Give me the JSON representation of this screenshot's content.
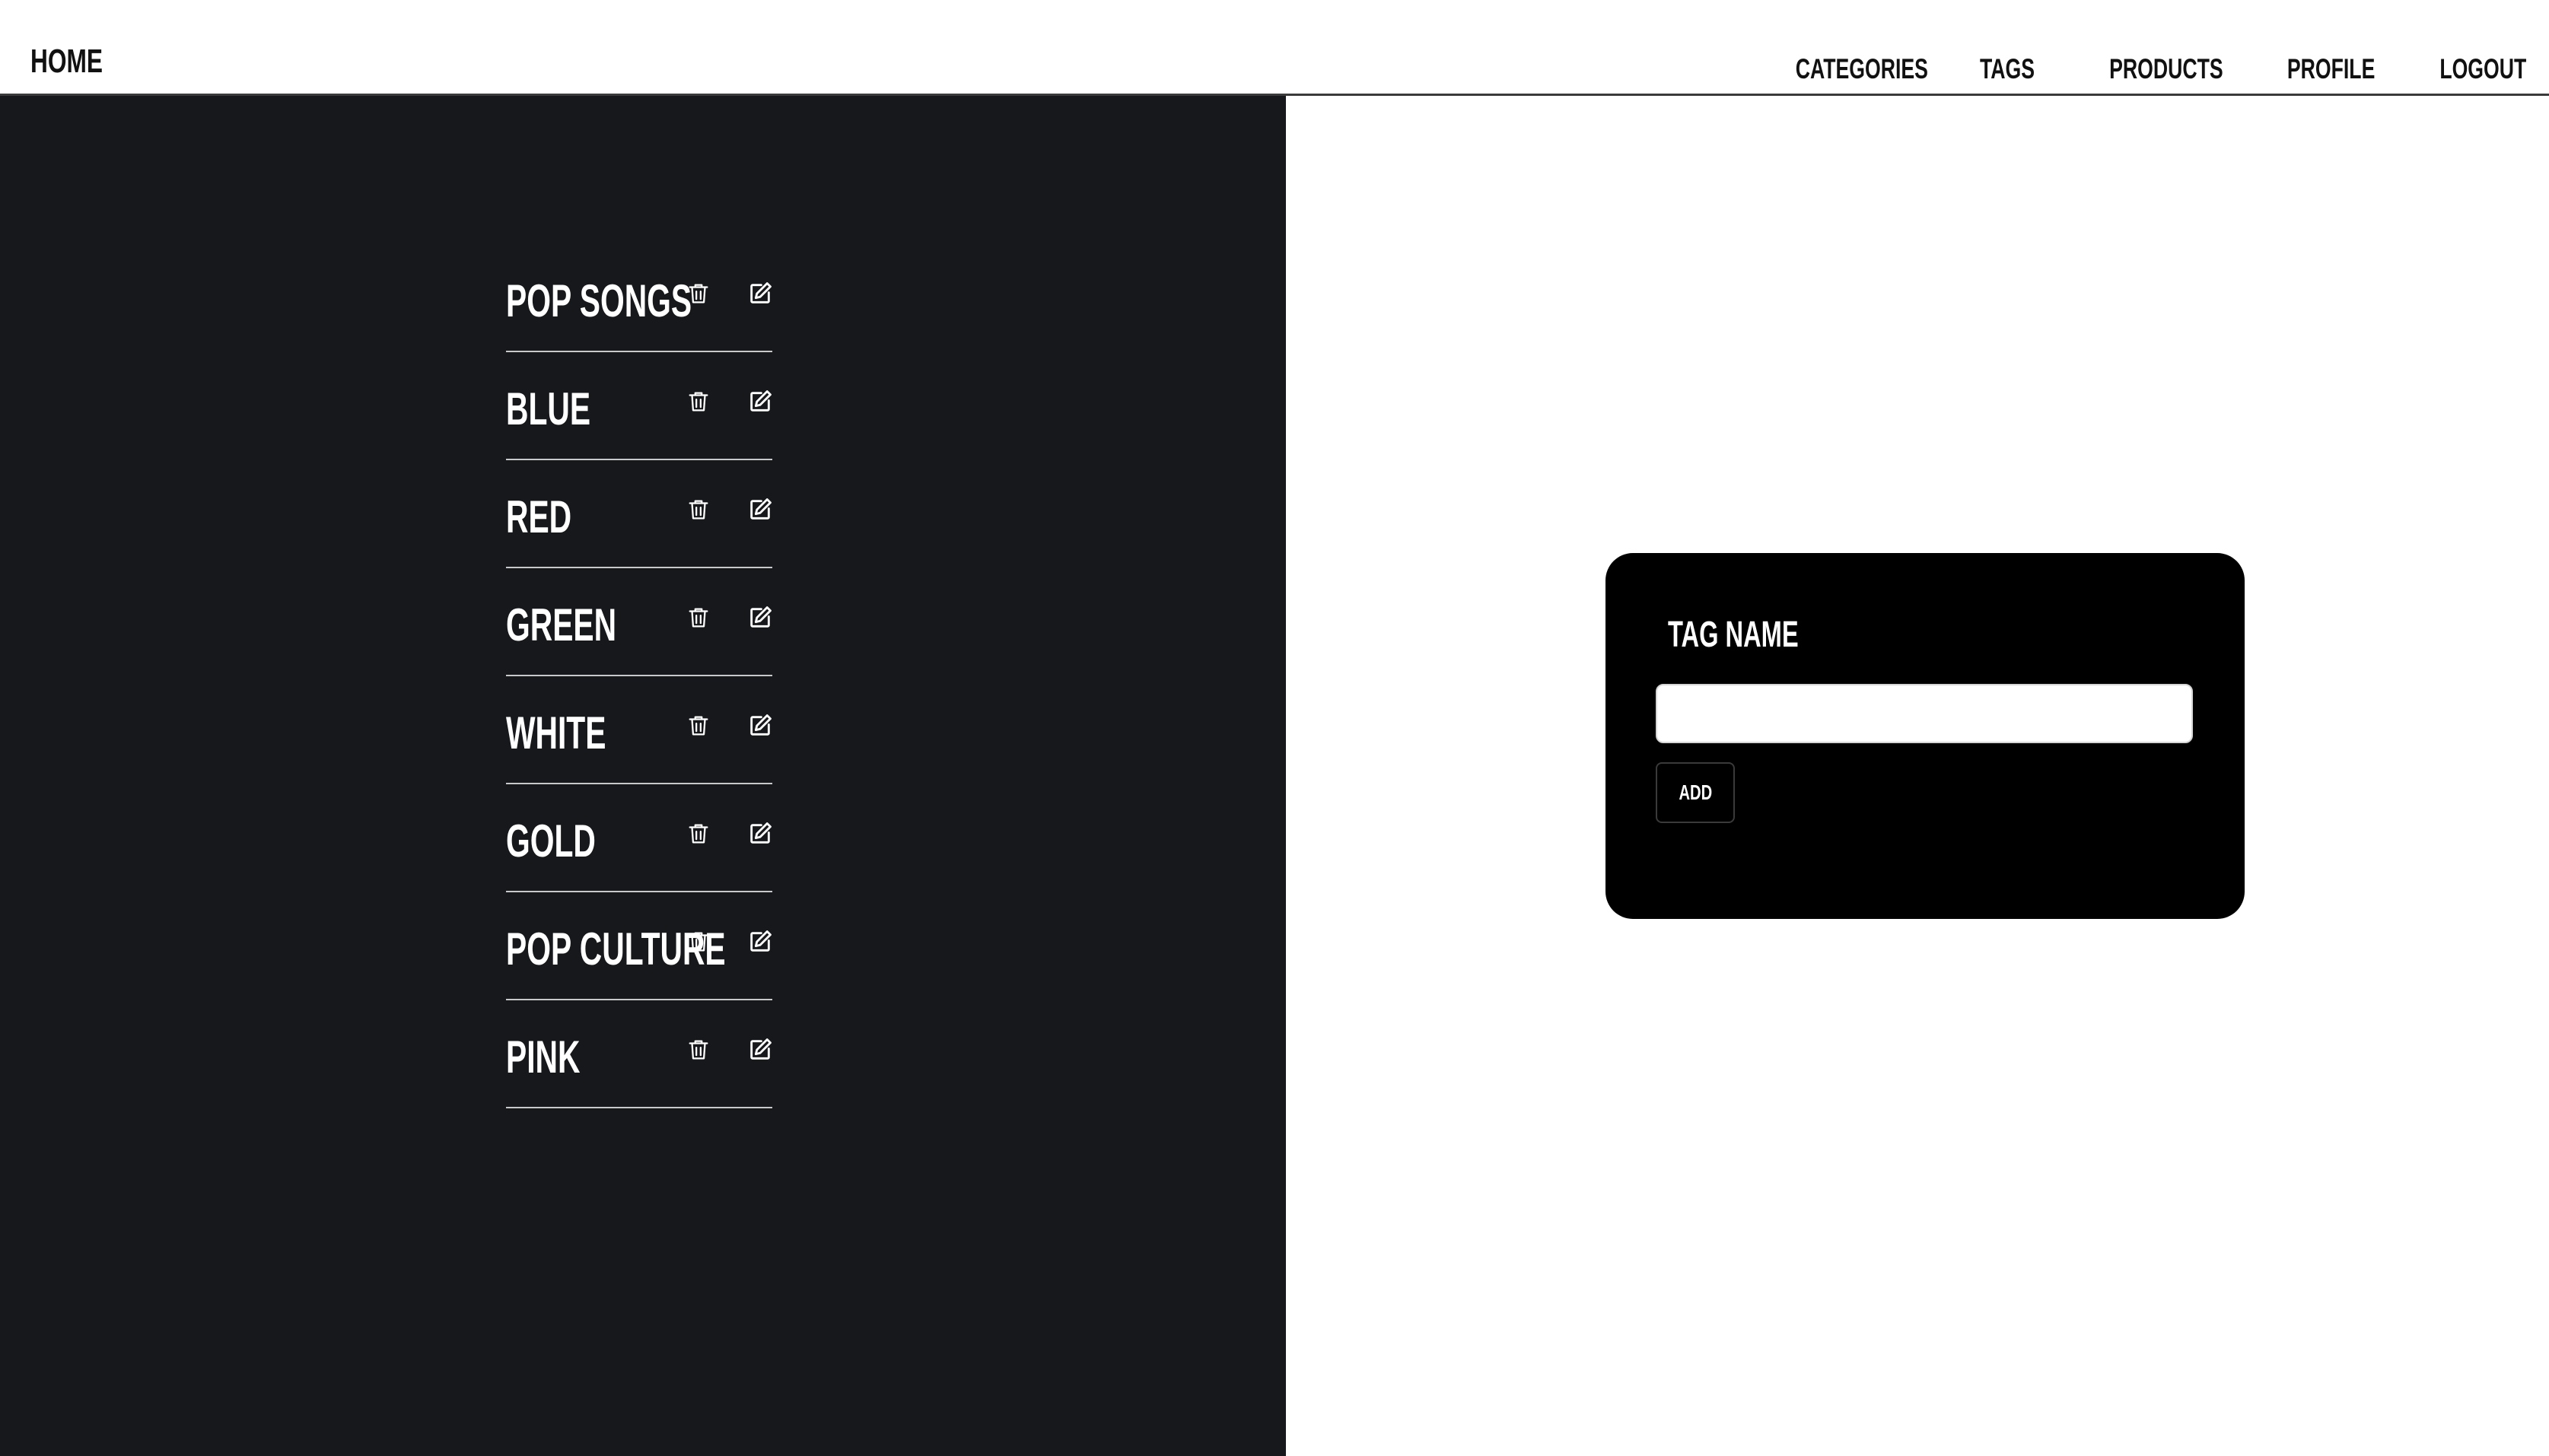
{
  "header": {
    "brand": "HOME",
    "nav": [
      {
        "label": "CATEGORIES"
      },
      {
        "label": "TAGS"
      },
      {
        "label": "PRODUCTS"
      },
      {
        "label": "PROFILE"
      },
      {
        "label": "LOGOUT"
      }
    ]
  },
  "tags": [
    {
      "name": "POP SONGS"
    },
    {
      "name": "BLUE"
    },
    {
      "name": "RED"
    },
    {
      "name": "GREEN"
    },
    {
      "name": "WHITE"
    },
    {
      "name": "GOLD"
    },
    {
      "name": "POP CULTURE"
    },
    {
      "name": "PINK"
    }
  ],
  "icons": {
    "delete": "trash-icon",
    "edit": "edit-icon"
  },
  "form": {
    "label": "TAG NAME",
    "input_value": "",
    "input_placeholder": "",
    "submit_label": "ADD"
  },
  "colors": {
    "left_panel_bg": "#17181c",
    "card_bg": "#000000",
    "text_light": "#ffffff",
    "text_dark": "#111111"
  }
}
